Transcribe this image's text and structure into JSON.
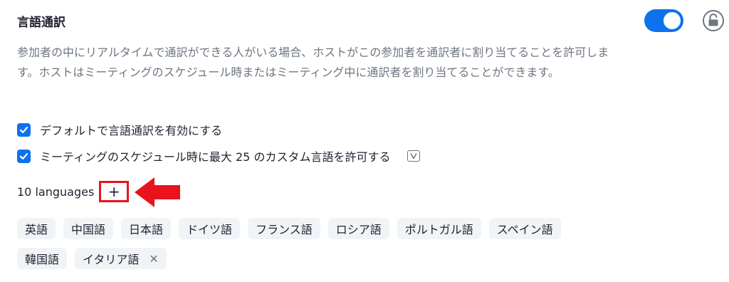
{
  "section": {
    "title": "言語通訳",
    "toggle_on": true,
    "description": "参加者の中にリアルタイムで通訳ができる人がいる場合、ホストがこの参加者を通訳者に割り当てることを許可します。ホストはミーティングのスケジュール時またはミーティング中に通訳者を割り当てることができます。"
  },
  "options": [
    {
      "label": "デフォルトで言語通訳を有効にする",
      "checked": true
    },
    {
      "label": "ミーティングのスケジュール時に最大 25 のカスタム言語を許可する",
      "checked": true
    }
  ],
  "languages": {
    "count_label": "10 languages",
    "add_label": "+",
    "row1": [
      "英語",
      "中国語",
      "日本語",
      "ドイツ語",
      "フランス語",
      "ロシア語",
      "ポルトガル語",
      "スペイン語"
    ],
    "row2": [
      "韓国語",
      "イタリア語"
    ]
  },
  "icons": {
    "lock": "lock-open-icon",
    "version": "v-badge-icon",
    "arrow": "red-arrow-left-icon",
    "remove": "close-icon"
  },
  "colors": {
    "accent": "#0e72ed",
    "highlight": "#e8131c",
    "chip_bg": "#f1f4f6",
    "muted_text": "#6e7680"
  }
}
